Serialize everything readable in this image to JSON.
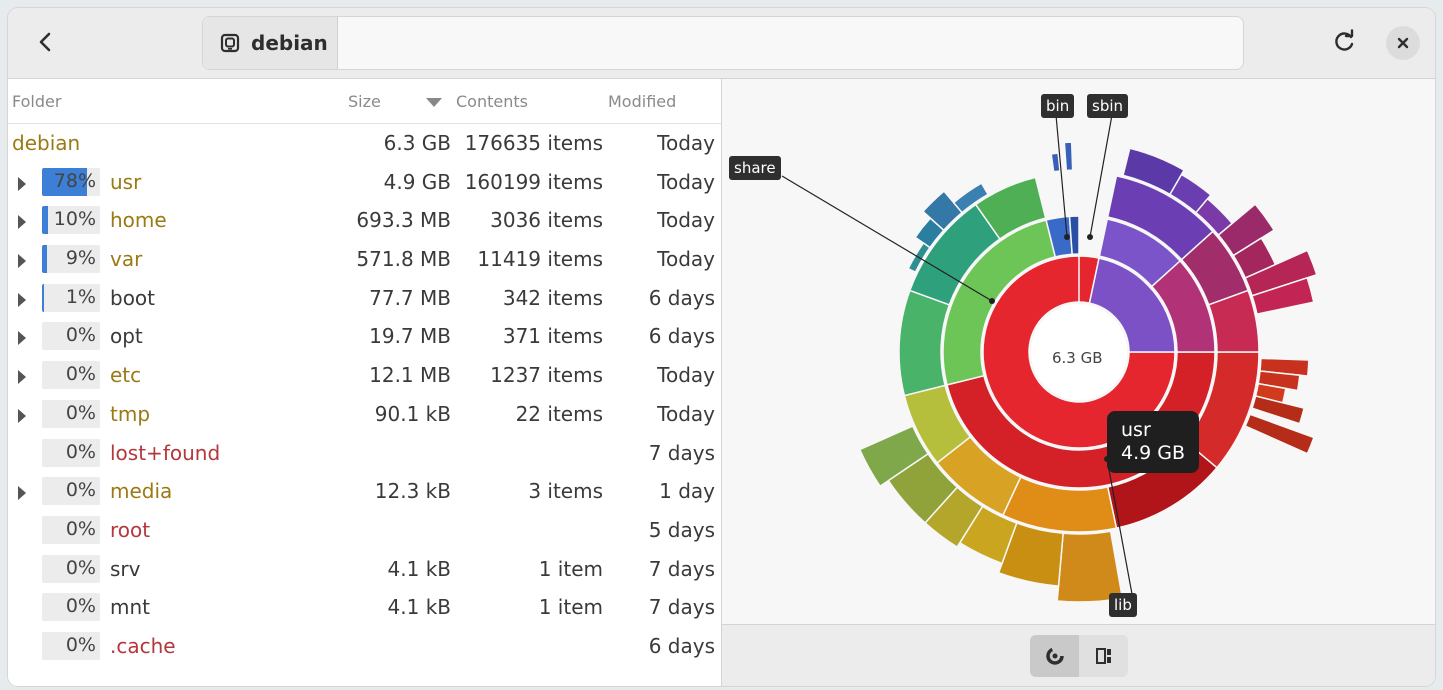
{
  "header": {
    "location_label": "debian"
  },
  "columns": {
    "folder": "Folder",
    "size": "Size",
    "contents": "Contents",
    "modified": "Modified"
  },
  "root": {
    "name": "debian",
    "size": "6.3 GB",
    "contents": "176635 items",
    "modified": "Today"
  },
  "rows": [
    {
      "pct_label": "78%",
      "pct": 78,
      "name": "usr",
      "size": "4.9 GB",
      "contents": "160199 items",
      "modified": "Today",
      "expandable": true,
      "color": "gold",
      "selected": true
    },
    {
      "pct_label": "10%",
      "pct": 10,
      "name": "home",
      "size": "693.3 MB",
      "contents": "3036 items",
      "modified": "Today",
      "expandable": true,
      "color": "gold"
    },
    {
      "pct_label": "9%",
      "pct": 9,
      "name": "var",
      "size": "571.8 MB",
      "contents": "11419 items",
      "modified": "Today",
      "expandable": true,
      "color": "gold"
    },
    {
      "pct_label": "1%",
      "pct": 1,
      "name": "boot",
      "size": "77.7 MB",
      "contents": "342 items",
      "modified": "6 days",
      "expandable": true,
      "color": "plain"
    },
    {
      "pct_label": "0%",
      "pct": 0,
      "name": "opt",
      "size": "19.7 MB",
      "contents": "371 items",
      "modified": "6 days",
      "expandable": true,
      "color": "plain"
    },
    {
      "pct_label": "0%",
      "pct": 0,
      "name": "etc",
      "size": "12.1 MB",
      "contents": "1237 items",
      "modified": "Today",
      "expandable": true,
      "color": "gold"
    },
    {
      "pct_label": "0%",
      "pct": 0,
      "name": "tmp",
      "size": "90.1 kB",
      "contents": "22 items",
      "modified": "Today",
      "expandable": true,
      "color": "gold"
    },
    {
      "pct_label": "0%",
      "pct": 0,
      "name": "lost+found",
      "size": "",
      "contents": "",
      "modified": "7 days",
      "expandable": false,
      "color": "red"
    },
    {
      "pct_label": "0%",
      "pct": 0,
      "name": "media",
      "size": "12.3 kB",
      "contents": "3 items",
      "modified": "1 day",
      "expandable": true,
      "color": "gold"
    },
    {
      "pct_label": "0%",
      "pct": 0,
      "name": "root",
      "size": "",
      "contents": "",
      "modified": "5 days",
      "expandable": false,
      "color": "red"
    },
    {
      "pct_label": "0%",
      "pct": 0,
      "name": "srv",
      "size": "4.1 kB",
      "contents": "1 item",
      "modified": "7 days",
      "expandable": false,
      "color": "plain"
    },
    {
      "pct_label": "0%",
      "pct": 0,
      "name": "mnt",
      "size": "4.1 kB",
      "contents": "1 item",
      "modified": "7 days",
      "expandable": false,
      "color": "plain"
    },
    {
      "pct_label": "0%",
      "pct": 0,
      "name": ".cache",
      "size": "",
      "contents": "",
      "modified": "6 days",
      "expandable": false,
      "color": "red"
    }
  ],
  "chart": {
    "center_label": "6.3 GB",
    "tooltip_name": "usr",
    "tooltip_size": "4.9 GB",
    "labels": {
      "share": "share",
      "bin": "bin",
      "sbin": "sbin",
      "lib": "lib"
    }
  },
  "colors": {
    "gold": "#9b7a14",
    "red": "#b5373b",
    "accent": "#3d7fd6"
  }
}
